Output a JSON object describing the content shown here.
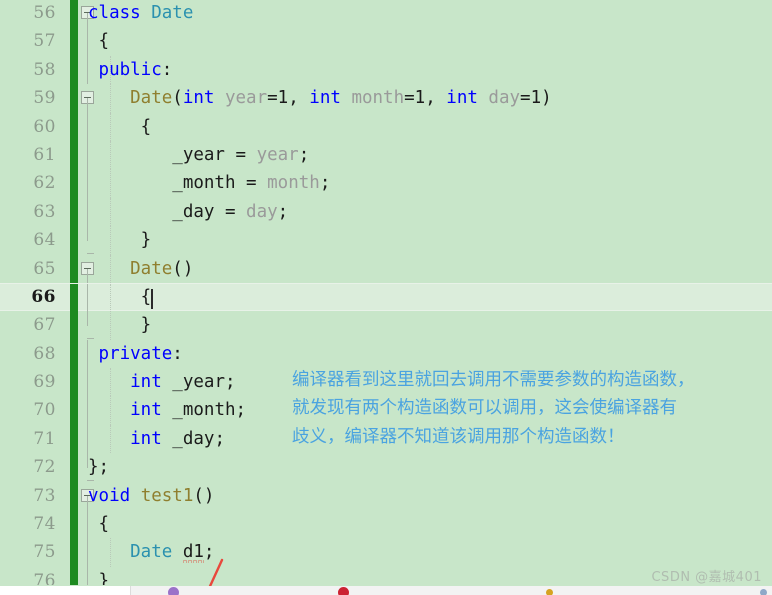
{
  "editor": {
    "language": "cpp",
    "current_line": 66,
    "colors": {
      "background": "#c8e6c9",
      "current_line": "#dbeddb",
      "change_bar": "#1d8a20",
      "line_number": "#8c9a8c",
      "keyword": "#0000ff",
      "type": "#2b91af",
      "function": "#8f7f2f",
      "parameter": "#9a9a9a",
      "plain": "#1a1a1a",
      "annotation": "#4aa3e0",
      "error_squiggle": "#e03b2e"
    },
    "lines": [
      {
        "num": "56",
        "fold": "open",
        "guide": false,
        "tokens": [
          {
            "t": "kw",
            "v": "class"
          },
          {
            "t": "pl",
            "v": " "
          },
          {
            "t": "type",
            "v": "Date"
          }
        ]
      },
      {
        "num": "57",
        "fold": "line",
        "guide": false,
        "tokens": [
          {
            "t": "pl",
            "v": " {"
          }
        ]
      },
      {
        "num": "58",
        "fold": "line",
        "guide": true,
        "tokens": [
          {
            "t": "kw",
            "v": " public"
          },
          {
            "t": "pl",
            "v": ":"
          }
        ]
      },
      {
        "num": "59",
        "fold": "open",
        "guide": true,
        "tokens": [
          {
            "t": "fn",
            "v": "    Date"
          },
          {
            "t": "pl",
            "v": "("
          },
          {
            "t": "kw",
            "v": "int"
          },
          {
            "t": "param",
            "v": " year"
          },
          {
            "t": "pl",
            "v": "=1, "
          },
          {
            "t": "kw",
            "v": "int"
          },
          {
            "t": "param",
            "v": " month"
          },
          {
            "t": "pl",
            "v": "=1, "
          },
          {
            "t": "kw",
            "v": "int"
          },
          {
            "t": "param",
            "v": " day"
          },
          {
            "t": "pl",
            "v": "=1)"
          }
        ]
      },
      {
        "num": "60",
        "fold": "line",
        "guide": true,
        "tokens": [
          {
            "t": "pl",
            "v": "     {"
          }
        ]
      },
      {
        "num": "61",
        "fold": "line",
        "guide": true,
        "tokens": [
          {
            "t": "pl",
            "v": "        _year = "
          },
          {
            "t": "param",
            "v": "year"
          },
          {
            "t": "pl",
            "v": ";"
          }
        ]
      },
      {
        "num": "62",
        "fold": "line",
        "guide": true,
        "tokens": [
          {
            "t": "pl",
            "v": "        _month = "
          },
          {
            "t": "param",
            "v": "month"
          },
          {
            "t": "pl",
            "v": ";"
          }
        ]
      },
      {
        "num": "63",
        "fold": "line",
        "guide": true,
        "tokens": [
          {
            "t": "pl",
            "v": "        _day = "
          },
          {
            "t": "param",
            "v": "day"
          },
          {
            "t": "pl",
            "v": ";"
          }
        ]
      },
      {
        "num": "64",
        "fold": "end",
        "guide": true,
        "tokens": [
          {
            "t": "pl",
            "v": "     }"
          }
        ]
      },
      {
        "num": "65",
        "fold": "open",
        "guide": true,
        "tokens": [
          {
            "t": "fn",
            "v": "    Date"
          },
          {
            "t": "pl",
            "v": "()"
          }
        ]
      },
      {
        "num": "66",
        "fold": "line",
        "guide": true,
        "current": true,
        "tokens": [
          {
            "t": "pl",
            "v": "     {"
          }
        ]
      },
      {
        "num": "67",
        "fold": "end",
        "guide": true,
        "tokens": [
          {
            "t": "pl",
            "v": "     }"
          }
        ]
      },
      {
        "num": "68",
        "fold": "line",
        "guide": false,
        "tokens": [
          {
            "t": "kw",
            "v": " private"
          },
          {
            "t": "pl",
            "v": ":"
          }
        ]
      },
      {
        "num": "69",
        "fold": "line",
        "guide": true,
        "tokens": [
          {
            "t": "kw",
            "v": "    int"
          },
          {
            "t": "pl",
            "v": " _year;"
          }
        ]
      },
      {
        "num": "70",
        "fold": "line",
        "guide": true,
        "tokens": [
          {
            "t": "kw",
            "v": "    int"
          },
          {
            "t": "pl",
            "v": " _month;"
          }
        ]
      },
      {
        "num": "71",
        "fold": "line",
        "guide": true,
        "tokens": [
          {
            "t": "kw",
            "v": "    int"
          },
          {
            "t": "pl",
            "v": " _day;"
          }
        ]
      },
      {
        "num": "72",
        "fold": "end",
        "guide": false,
        "tokens": [
          {
            "t": "pl",
            "v": "};"
          }
        ]
      },
      {
        "num": "73",
        "fold": "open",
        "guide": false,
        "tokens": [
          {
            "t": "kw",
            "v": "void"
          },
          {
            "t": "pl",
            "v": " "
          },
          {
            "t": "fn",
            "v": "test1"
          },
          {
            "t": "pl",
            "v": "()"
          }
        ]
      },
      {
        "num": "74",
        "fold": "line",
        "guide": false,
        "tokens": [
          {
            "t": "pl",
            "v": " {"
          }
        ]
      },
      {
        "num": "75",
        "fold": "line",
        "guide": true,
        "tokens": [
          {
            "t": "type",
            "v": "    Date"
          },
          {
            "t": "pl",
            "v": " "
          },
          {
            "t": "err",
            "v": "d1"
          },
          {
            "t": "pl",
            "v": ";"
          }
        ]
      },
      {
        "num": "76",
        "fold": "line",
        "guide": false,
        "tokens": [
          {
            "t": "pl",
            "v": " }"
          }
        ]
      }
    ]
  },
  "annotation": {
    "color": "#4aa3e0",
    "lines": [
      "编译器看到这里就回去调用不需要参数的构造函数，",
      "就发现有两个构造函数可以调用，这会使编译器有",
      "歧义，编译器不知道该调用那个构造函数！"
    ]
  },
  "watermark": {
    "text": "CSDN @嘉城401"
  },
  "bottom_strip": {
    "items": [
      {
        "color": "#9b72c9",
        "label": ""
      },
      {
        "color": "#cc2233",
        "label": ""
      },
      {
        "color": "#d6a321",
        "label": ""
      },
      {
        "color": "#8fa8c8",
        "label": ""
      }
    ]
  }
}
